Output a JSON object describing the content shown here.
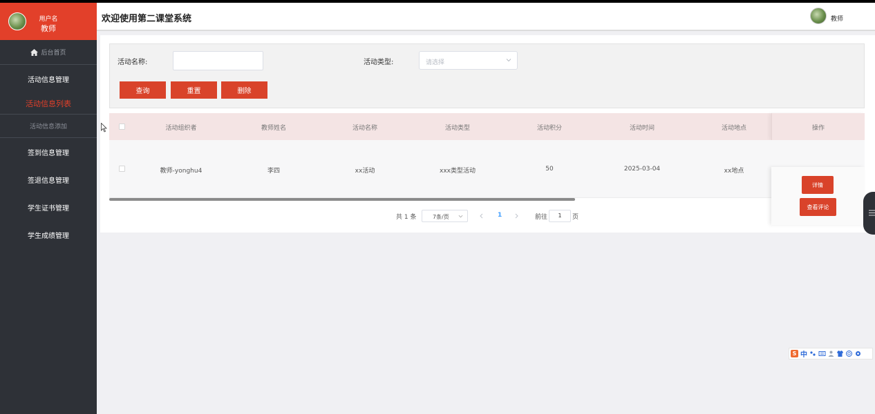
{
  "sidebar": {
    "user_label": "用户名",
    "user_role": "教师",
    "home": "后台首页",
    "groups": [
      {
        "label": "活动信息管理"
      },
      {
        "label": "签到信息管理"
      },
      {
        "label": "签退信息管理"
      },
      {
        "label": "学生证书管理"
      },
      {
        "label": "学生成绩管理"
      }
    ],
    "active_item": "活动信息列表",
    "sub_item": "活动信息添加"
  },
  "header": {
    "title": "欢迎使用第二课堂系统",
    "user": "教师"
  },
  "search": {
    "name_label": "活动名称:",
    "name_value": "",
    "type_label": "活动类型:",
    "type_placeholder": "请选择",
    "btn_query": "查询",
    "btn_reset": "重置",
    "btn_delete": "删除"
  },
  "table": {
    "headers": [
      "活动组织者",
      "教师姓名",
      "活动名称",
      "活动类型",
      "活动积分",
      "活动时间",
      "活动地点",
      "操作"
    ],
    "rows": [
      {
        "organizer": "教师-yonghu4",
        "teacher": "李四",
        "name": "xx活动",
        "type": "xxx类型活动",
        "points": "50",
        "time": "2025-03-04",
        "location": "xx地点",
        "btn_detail": "详情",
        "btn_comments": "查看评论"
      }
    ]
  },
  "pagination": {
    "total": "共 1 条",
    "page_size": "7条/页",
    "current_page": "1",
    "goto_label": "前往",
    "goto_value": "1",
    "page_suffix": "页"
  },
  "ime": {
    "logo": "S",
    "mode": "中"
  },
  "colors": {
    "accent": "#e2402a",
    "sidebar_bg": "#2e3137",
    "button": "#d9432a",
    "table_header_bg": "#f4e4e4"
  }
}
